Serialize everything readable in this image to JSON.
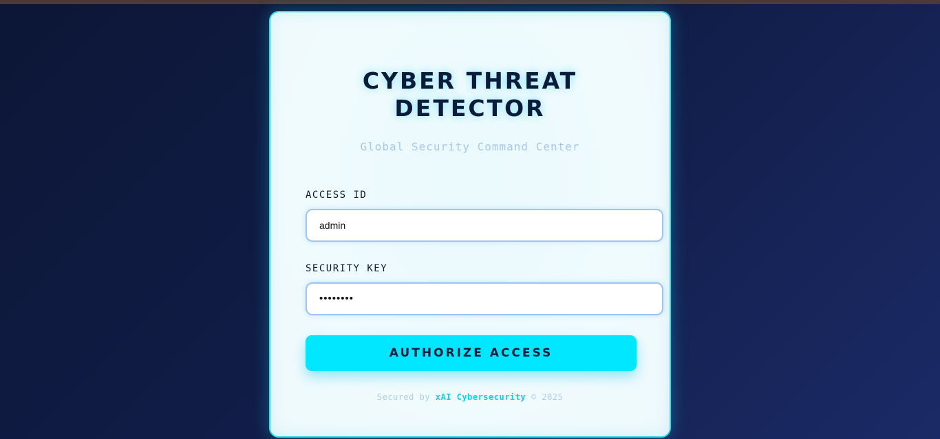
{
  "header": {
    "title": "CYBER THREAT\nDETECTOR",
    "subtitle": "Global Security Command Center"
  },
  "form": {
    "access_id": {
      "label": "ACCESS ID",
      "value": "admin"
    },
    "security_key": {
      "label": "SECURITY KEY",
      "value": "••••••••"
    },
    "submit_label": "AUTHORIZE ACCESS"
  },
  "footer": {
    "prefix": "Secured by",
    "brand": "xAI Cybersecurity",
    "suffix": "© 2025"
  },
  "colors": {
    "accent": "#00e7ff",
    "title_text": "#0d1b3a",
    "background": "#111d48"
  }
}
